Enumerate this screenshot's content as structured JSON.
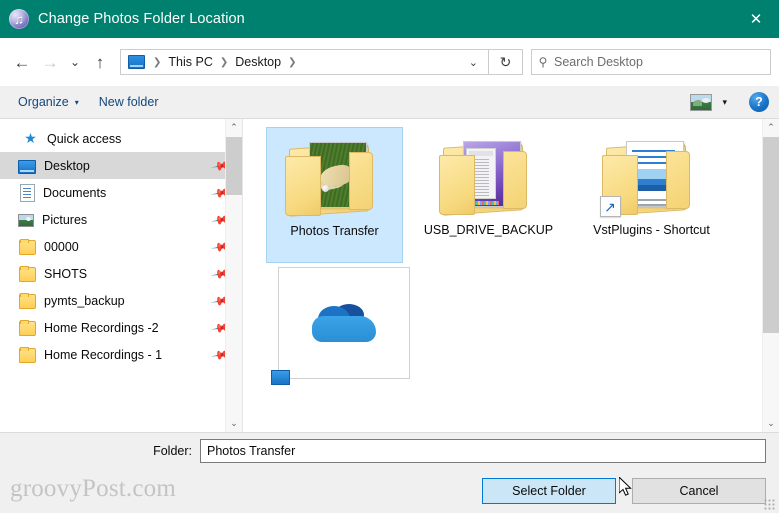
{
  "window": {
    "title": "Change Photos Folder Location",
    "app_icon": "itunes-music-note-icon",
    "close_label": "✕",
    "titlebar_color": "#00806e"
  },
  "nav": {
    "back_icon": "←",
    "forward_icon": "→",
    "recent_icon": "⌄",
    "up_icon": "↑",
    "refresh_icon": "↻",
    "dropdown_icon": "⌄",
    "breadcrumbs": [
      {
        "label": "This PC"
      },
      {
        "label": "Desktop"
      }
    ],
    "separator": "❯"
  },
  "search": {
    "placeholder": "Search Desktop",
    "icon": "search-icon",
    "value": ""
  },
  "toolbar": {
    "organize_label": "Organize",
    "organize_caret": "▾",
    "new_folder_label": "New folder",
    "view_icon": "picture-view-icon",
    "view_caret": "▾",
    "help_label": "?"
  },
  "sidebar": {
    "group": {
      "label": "Quick access",
      "icon": "star-pin-icon"
    },
    "items": [
      {
        "label": "Desktop",
        "icon": "monitor-icon",
        "pinned": true,
        "selected": true
      },
      {
        "label": "Documents",
        "icon": "document-icon",
        "pinned": true,
        "selected": false
      },
      {
        "label": "Pictures",
        "icon": "picture-icon",
        "pinned": true,
        "selected": false
      },
      {
        "label": "00000",
        "icon": "folder-icon",
        "pinned": true,
        "selected": false
      },
      {
        "label": "SHOTS",
        "icon": "folder-icon",
        "pinned": true,
        "selected": false
      },
      {
        "label": "pymts_backup",
        "icon": "folder-icon",
        "pinned": true,
        "selected": false
      },
      {
        "label": "Home Recordings -2",
        "icon": "folder-icon",
        "pinned": true,
        "selected": false
      },
      {
        "label": "Home Recordings - 1",
        "icon": "folder-icon",
        "pinned": true,
        "selected": false
      }
    ],
    "pin_icon": "pin-icon",
    "scroll_up_icon": "⌃",
    "scroll_down_icon": "⌄"
  },
  "files": {
    "items": [
      {
        "label": "Photos Transfer",
        "icon": "folder-photo-thumbnail",
        "selected": true,
        "shortcut": false
      },
      {
        "label": "USB_DRIVE_BACKUP",
        "icon": "folder-screenshot-thumbnail",
        "selected": false,
        "shortcut": false
      },
      {
        "label": "VstPlugins - Shortcut",
        "icon": "folder-document-thumbnail",
        "selected": false,
        "shortcut": true
      },
      {
        "label": "",
        "icon": "onedrive-cloud-icon",
        "selected": false,
        "shortcut": false
      }
    ],
    "scroll_up_icon": "⌃",
    "scroll_down_icon": "⌄"
  },
  "footer": {
    "folder_label": "Folder:",
    "folder_value": "Photos Transfer",
    "select_button": "Select Folder",
    "cancel_button": "Cancel",
    "watermark": "groovyPost.com"
  },
  "colors": {
    "accent_teal": "#00806e",
    "selection_blue": "#cce8ff",
    "primary_border": "#0078d7",
    "link_blue": "#14477d"
  }
}
